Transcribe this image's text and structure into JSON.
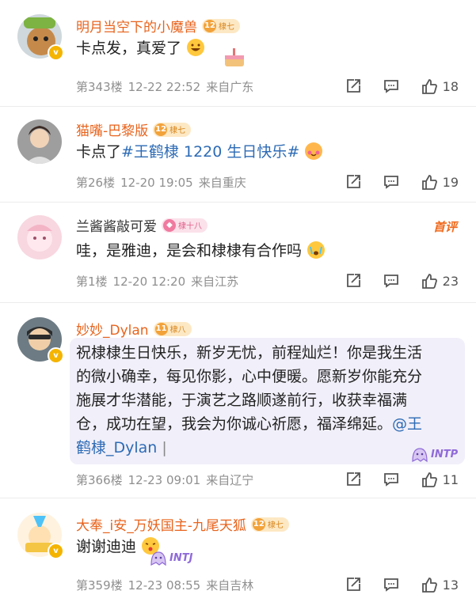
{
  "comments": [
    {
      "name": "明月当空下的小魔兽",
      "level": "12",
      "level_tag": "棣七",
      "text": "卡点发，真爱了",
      "floor": "第343楼",
      "time": "12-22 22:52",
      "location": "来自广东",
      "likes": "18"
    },
    {
      "name": "猫嘴-巴黎版",
      "level": "12",
      "level_tag": "棣七",
      "text_prefix": "卡点了",
      "hashtag": "#王鹤棣 1220 生日快乐#",
      "floor": "第26楼",
      "time": "12-20 19:05",
      "location": "来自重庆",
      "likes": "19"
    },
    {
      "name": "兰酱酱敲可爱",
      "level": "",
      "level_tag": "棣十八",
      "hot_label": "首评",
      "text": "哇，是雅迪，是会和棣棣有合作吗",
      "floor": "第1楼",
      "time": "12-20 12:20",
      "location": "来自江苏",
      "likes": "23"
    },
    {
      "name": "妙妙_Dylan",
      "level": "11",
      "level_tag": "棣八",
      "text_lines": [
        "祝棣棣生日快乐，新岁无忧，前程灿烂！你是我生活",
        "的微小确幸，每见你影，心中便暖。愿新岁你能充分",
        "施展才华潜能，于演艺之路顺遂前行，收获幸福满",
        "仓，成功在望，我会为你诚心祈愿，福泽绵延。"
      ],
      "mention_a": "@王",
      "mention_b": "鹤棣_Dylan",
      "sticker": "INTP",
      "floor": "第366楼",
      "time": "12-23 09:01",
      "location": "来自辽宁",
      "likes": "11"
    },
    {
      "name": "大奉_i安_万妖国主-九尾天狐",
      "level": "12",
      "level_tag": "棣七",
      "text": "谢谢迪迪",
      "sticker": "INTJ",
      "floor": "第359楼",
      "time": "12-23 08:55",
      "location": "来自吉林",
      "likes": "13"
    }
  ],
  "colors": {
    "name": "#e8631c",
    "link": "#2d6bb5",
    "meta": "#8f8f8f",
    "hot": "#f06a1d"
  },
  "icons": [
    "share-icon",
    "comment-icon",
    "like-icon",
    "verified-icon"
  ]
}
